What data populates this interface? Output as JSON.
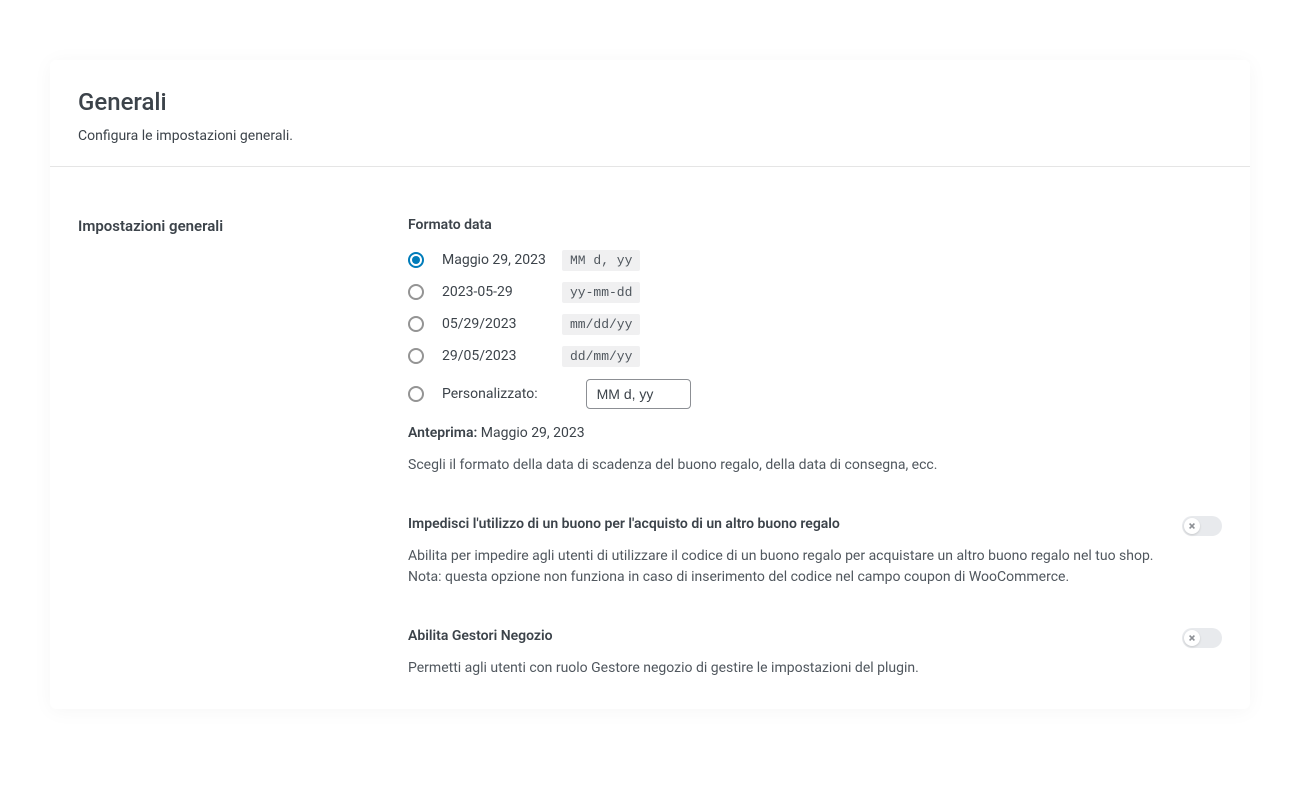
{
  "header": {
    "title": "Generali",
    "subtitle": "Configura le impostazioni generali."
  },
  "section": {
    "title": "Impostazioni generali"
  },
  "dateFormat": {
    "label": "Formato data",
    "options": [
      {
        "example": "Maggio 29, 2023",
        "code": "MM d, yy",
        "checked": true
      },
      {
        "example": "2023-05-29",
        "code": "yy-mm-dd",
        "checked": false
      },
      {
        "example": "05/29/2023",
        "code": "mm/dd/yy",
        "checked": false
      },
      {
        "example": "29/05/2023",
        "code": "dd/mm/yy",
        "checked": false
      }
    ],
    "custom": {
      "label": "Personalizzato:",
      "value": "MM d, yy"
    },
    "preview": {
      "label": "Anteprima:",
      "value": "Maggio 29, 2023"
    },
    "help": "Scegli il formato della data di scadenza del buono regalo, della data di consegna, ecc."
  },
  "togglePrevent": {
    "label": "Impedisci l'utilizzo di un buono per l'acquisto di un altro buono regalo",
    "desc": "Abilita per impedire agli utenti di utilizzare il codice di un buono regalo per acquistare un altro buono regalo nel tuo shop. Nota: questa opzione non funziona in caso di inserimento del codice nel campo coupon di WooCommerce."
  },
  "toggleShopManagers": {
    "label": "Abilita Gestori Negozio",
    "desc": "Permetti agli utenti con ruolo Gestore negozio di gestire le impostazioni del plugin."
  }
}
